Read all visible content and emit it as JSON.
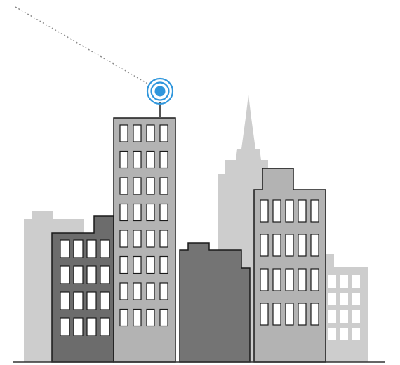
{
  "illustration": {
    "subject": "city-skyline-with-antenna-signal",
    "colors": {
      "background": "#ffffff",
      "building_light": "#cdcdcd",
      "building_mid": "#b3b3b3",
      "building_dark": "#7c7c7c",
      "building_darker": "#6a6a6a",
      "window": "#ffffff",
      "outline": "#1a1a1a",
      "signal": "#2f96dc",
      "signal_line": "#888888",
      "ground": "#333333"
    }
  }
}
